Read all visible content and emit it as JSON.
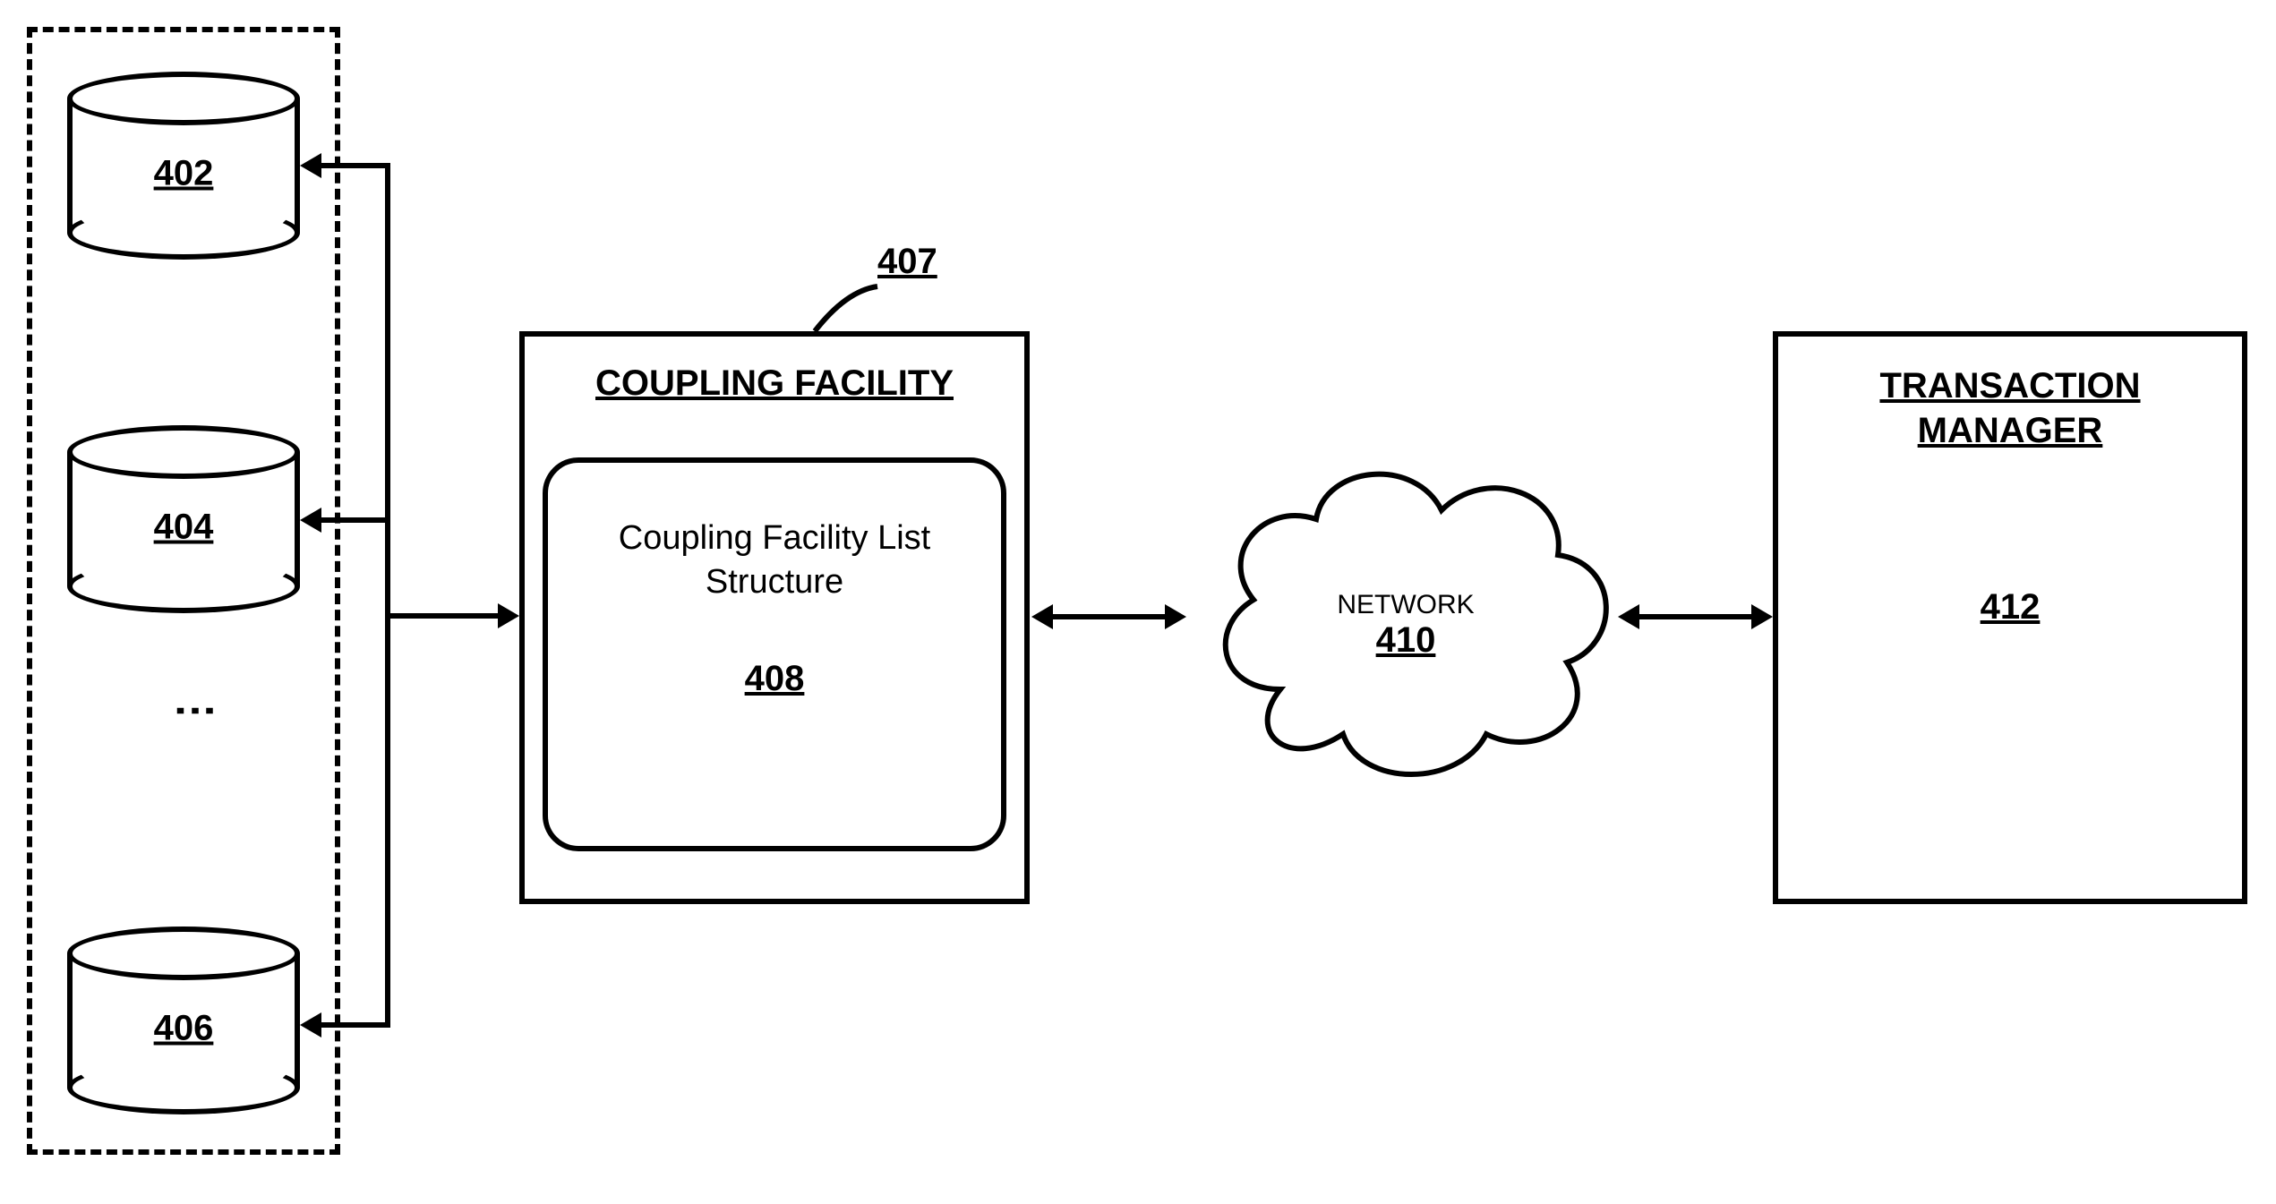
{
  "dbGroup": {
    "db1": "402",
    "db2": "404",
    "db3": "406"
  },
  "coupling": {
    "calloutRef": "407",
    "title": "COUPLING FACILITY",
    "inner": {
      "text": "Coupling Facility List Structure",
      "ref": "408"
    }
  },
  "network": {
    "label": "NETWORK",
    "ref": "410"
  },
  "txnManager": {
    "title": "TRANSACTION MANAGER",
    "ref": "412"
  }
}
